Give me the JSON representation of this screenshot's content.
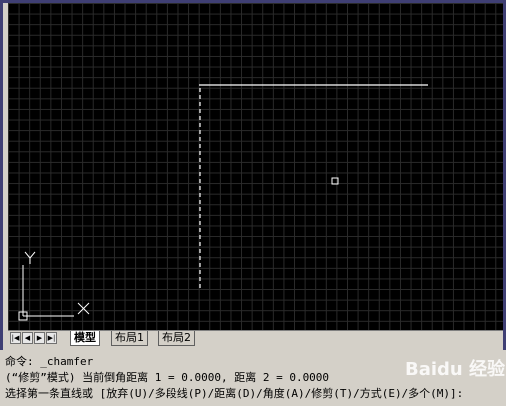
{
  "tabs": {
    "model": "模型",
    "layout1": "布局1",
    "layout2": "布局2"
  },
  "ucs": {
    "y_label": "Y",
    "x_label": "X"
  },
  "command_lines": [
    "命令: _chamfer",
    "(“修剪”模式) 当前倒角距离 1 = 0.0000, 距离 2 = 0.0000",
    "选择第一条直线或 [放弃(U)/多段线(P)/距离(D)/角度(A)/修剪(T)/方式(E)/多个(M)]:"
  ],
  "watermark": "Baidu 经验",
  "colors": {
    "canvas_bg": "#000000",
    "grid": "#2b2b2b",
    "entity": "#ffffff",
    "frame": "#3f3f74"
  }
}
